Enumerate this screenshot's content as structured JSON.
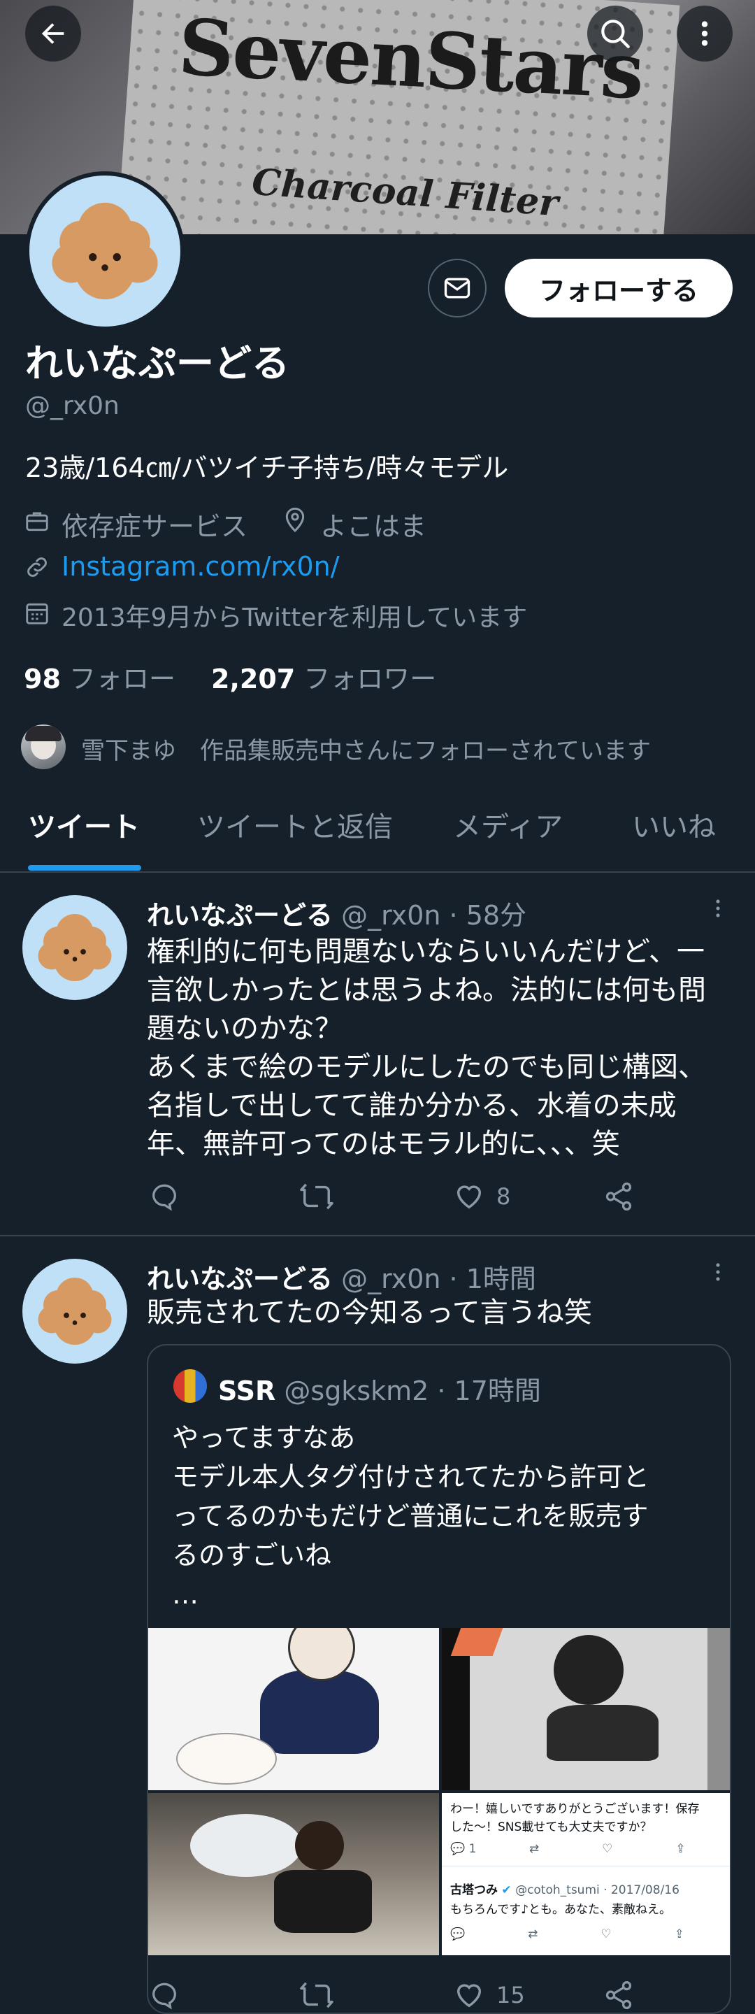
{
  "banner": {
    "brand_text": "SevenStars",
    "sub_text": "Charcoal Filter"
  },
  "header": {
    "back_icon": "arrow-left-icon",
    "search_icon": "search-icon",
    "more_icon": "more-vertical-icon"
  },
  "profile": {
    "display_name": "れいなぷーどる",
    "handle": "@_rx0n",
    "bio": "23歳/164㎝/バツイチ子持ち/時々モデル",
    "category": "依存症サービス",
    "location": "よこはま",
    "website": "Instagram.com/rx0n/",
    "joined": "2013年9月からTwitterを利用しています",
    "following_count": "98",
    "following_label": "フォロー",
    "followers_count": "2,207",
    "followers_label": "フォロワー",
    "followed_by": "雪下まゆ　作品集販売中さんにフォローされています",
    "follow_button": "フォローする",
    "message_icon": "envelope-icon"
  },
  "tabs": [
    "ツイート",
    "ツイートと返信",
    "メディア",
    "いいね"
  ],
  "tweets": [
    {
      "name": "れいなぷーどる",
      "meta": "@_rx0n · 58分",
      "text": "権利的に何も問題ないならいいんだけど、一\n言欲しかったとは思うよね。法的には何も問\n題ないのかな？\nあくまで絵のモデルにしたのでも同じ構図、\n名指しで出してて誰か分かる、水着の未成\n年、無許可ってのはモラル的に、、、笑",
      "likes": "8"
    },
    {
      "name": "れいなぷーどる",
      "meta": "@_rx0n · 1時間",
      "text": "販売されてたの今知るって言うね笑",
      "likes": "15",
      "quote": {
        "name": "SSR",
        "meta": "@sgkskm2 · 17時間",
        "text": "やってますなあ\nモデル本人タグ付けされてたから許可と\nってるのかもだけど普通にこれを販売す\nるのすごいね\n…",
        "screenshot": {
          "line1": "わー！嬉しいですありがとうございます！保存",
          "line2": "した〜！SNS載せても大丈夫ですか？",
          "reply_count": "1",
          "user": "古塔つみ",
          "user_meta": "@cotoh_tsumi · 2017/08/16",
          "reply": "もちろんです♪とも。あなた、素敵ねえ。"
        }
      }
    }
  ],
  "colors": {
    "background": "#15202b",
    "accent": "#1d9bf0",
    "muted": "#8b98a5",
    "divider": "#38444d"
  }
}
